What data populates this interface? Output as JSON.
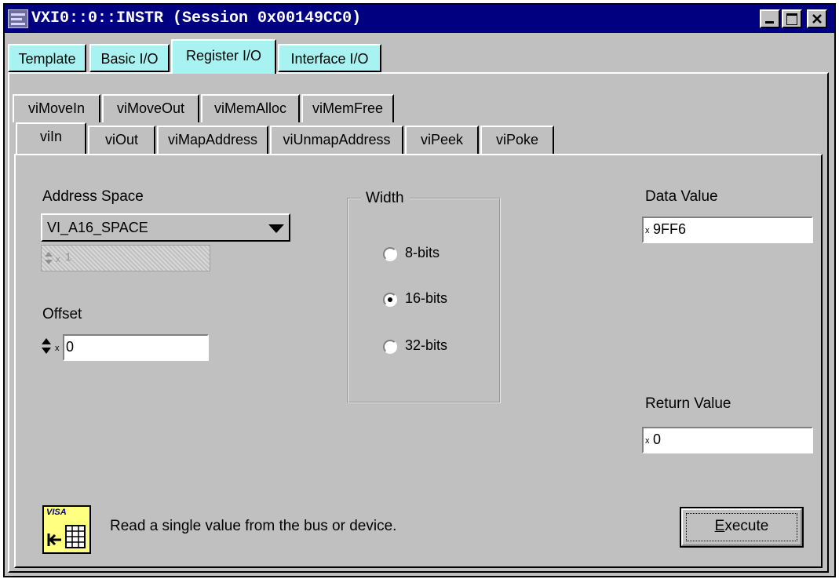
{
  "window": {
    "title": "VXI0::0::INSTR (Session 0x00149CC0)"
  },
  "outer_tabs": [
    {
      "label": "Template"
    },
    {
      "label": "Basic I/O"
    },
    {
      "label": "Register I/O"
    },
    {
      "label": "Interface I/O"
    }
  ],
  "inner_tabs_row1": [
    {
      "label": "viMoveIn"
    },
    {
      "label": "viMoveOut"
    },
    {
      "label": "viMemAlloc"
    },
    {
      "label": "viMemFree"
    }
  ],
  "inner_tabs_row2": [
    {
      "label": "viIn"
    },
    {
      "label": "viOut"
    },
    {
      "label": "viMapAddress"
    },
    {
      "label": "viUnmapAddress"
    },
    {
      "label": "viPeek"
    },
    {
      "label": "viPoke"
    }
  ],
  "address_space": {
    "label": "Address Space",
    "value": "VI_A16_SPACE",
    "disabled_spin_value": "1"
  },
  "offset": {
    "label": "Offset",
    "prefix": "x",
    "value": "0"
  },
  "width": {
    "label": "Width",
    "options": [
      {
        "label": "8-bits",
        "selected": false
      },
      {
        "label": "16-bits",
        "selected": true
      },
      {
        "label": "32-bits",
        "selected": false
      }
    ]
  },
  "data_value": {
    "label": "Data Value",
    "prefix": "x",
    "value": "9FF6"
  },
  "return_value": {
    "label": "Return Value",
    "prefix": "x",
    "value": "0"
  },
  "footer": {
    "badge_text": "VISA",
    "description": "Read a single value from the bus or device."
  },
  "execute": {
    "mnemonic": "E",
    "rest": "xecute"
  },
  "colors": {
    "title_bar": "#000080",
    "outer_tab": "#a8f2f2",
    "face": "#c0c0c0",
    "badge": "#ffff80"
  }
}
